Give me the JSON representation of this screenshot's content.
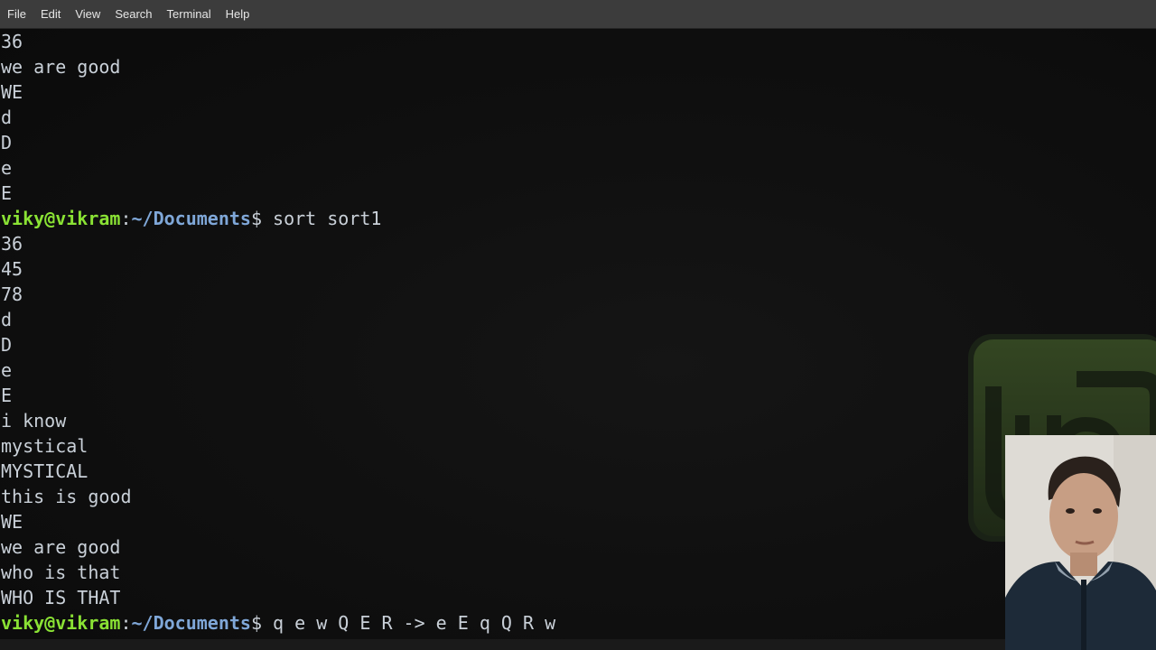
{
  "menubar": {
    "items": [
      "File",
      "Edit",
      "View",
      "Search",
      "Terminal",
      "Help"
    ]
  },
  "terminal": {
    "prompt": {
      "user_host": "viky@vikram",
      "separator": ":",
      "path": "~/Documents",
      "dollar": "$"
    },
    "lines": [
      {
        "kind": "output",
        "text": "36"
      },
      {
        "kind": "output",
        "text": "we are good"
      },
      {
        "kind": "output",
        "text": "WE"
      },
      {
        "kind": "output",
        "text": "d"
      },
      {
        "kind": "output",
        "text": "D"
      },
      {
        "kind": "output",
        "text": "e"
      },
      {
        "kind": "output",
        "text": "E"
      },
      {
        "kind": "prompt",
        "command": " sort sort1"
      },
      {
        "kind": "output",
        "text": "36"
      },
      {
        "kind": "output",
        "text": "45"
      },
      {
        "kind": "output",
        "text": "78"
      },
      {
        "kind": "output",
        "text": "d"
      },
      {
        "kind": "output",
        "text": "D"
      },
      {
        "kind": "output",
        "text": "e"
      },
      {
        "kind": "output",
        "text": "E"
      },
      {
        "kind": "output",
        "text": "i know"
      },
      {
        "kind": "output",
        "text": "mystical"
      },
      {
        "kind": "output",
        "text": "MYSTICAL"
      },
      {
        "kind": "output",
        "text": "this is good"
      },
      {
        "kind": "output",
        "text": "WE"
      },
      {
        "kind": "output",
        "text": "we are good"
      },
      {
        "kind": "output",
        "text": "who is that"
      },
      {
        "kind": "output",
        "text": "WHO IS THAT"
      },
      {
        "kind": "prompt",
        "command": " q e w Q E R -> e E q Q R w"
      }
    ]
  },
  "colors": {
    "menubar_bg": "#3c3c3c",
    "terminal_bg": "#0d0d0d",
    "text": "#c9d0d8",
    "prompt_user": "#8ae234",
    "prompt_path": "#7fa7d8",
    "logo_green": "#6b8f3a"
  },
  "overlay": {
    "webcam": "webcam-video-presenter",
    "wallpaper_logo": "linux-mint-logo"
  }
}
